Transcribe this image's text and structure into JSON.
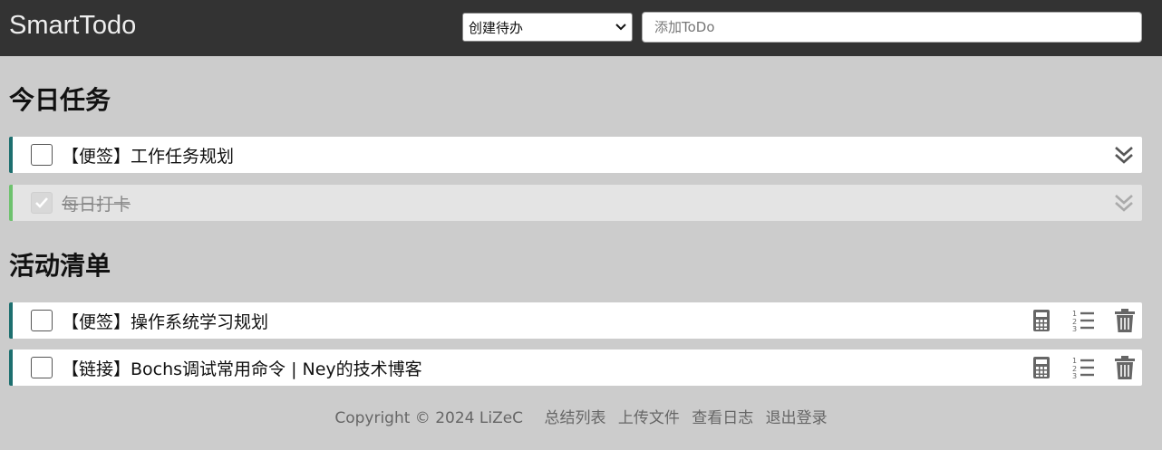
{
  "header": {
    "brand": "SmartTodo",
    "type_select": {
      "selected": "创建待办"
    },
    "todo_input": {
      "placeholder": "添加ToDo",
      "value": ""
    }
  },
  "sections": {
    "today_title": "今日任务",
    "activity_title": "活动清单"
  },
  "today_items": [
    {
      "label": "【便签】工作任务规划",
      "done": false
    },
    {
      "label": "每日打卡",
      "done": true
    }
  ],
  "activity_items": [
    {
      "label": "【便签】操作系统学习规划"
    },
    {
      "label": "【链接】Bochs调试常用命令 | Ney的技术博客"
    }
  ],
  "footer": {
    "copyright": "Copyright © 2024 LiZeC",
    "links": [
      "总结列表",
      "上传文件",
      "查看日志",
      "退出登录"
    ]
  },
  "colors": {
    "topbar": "#333333",
    "background": "#cccccc",
    "item_accent": "#1d6f6f",
    "done_accent": "#6ec26e"
  }
}
